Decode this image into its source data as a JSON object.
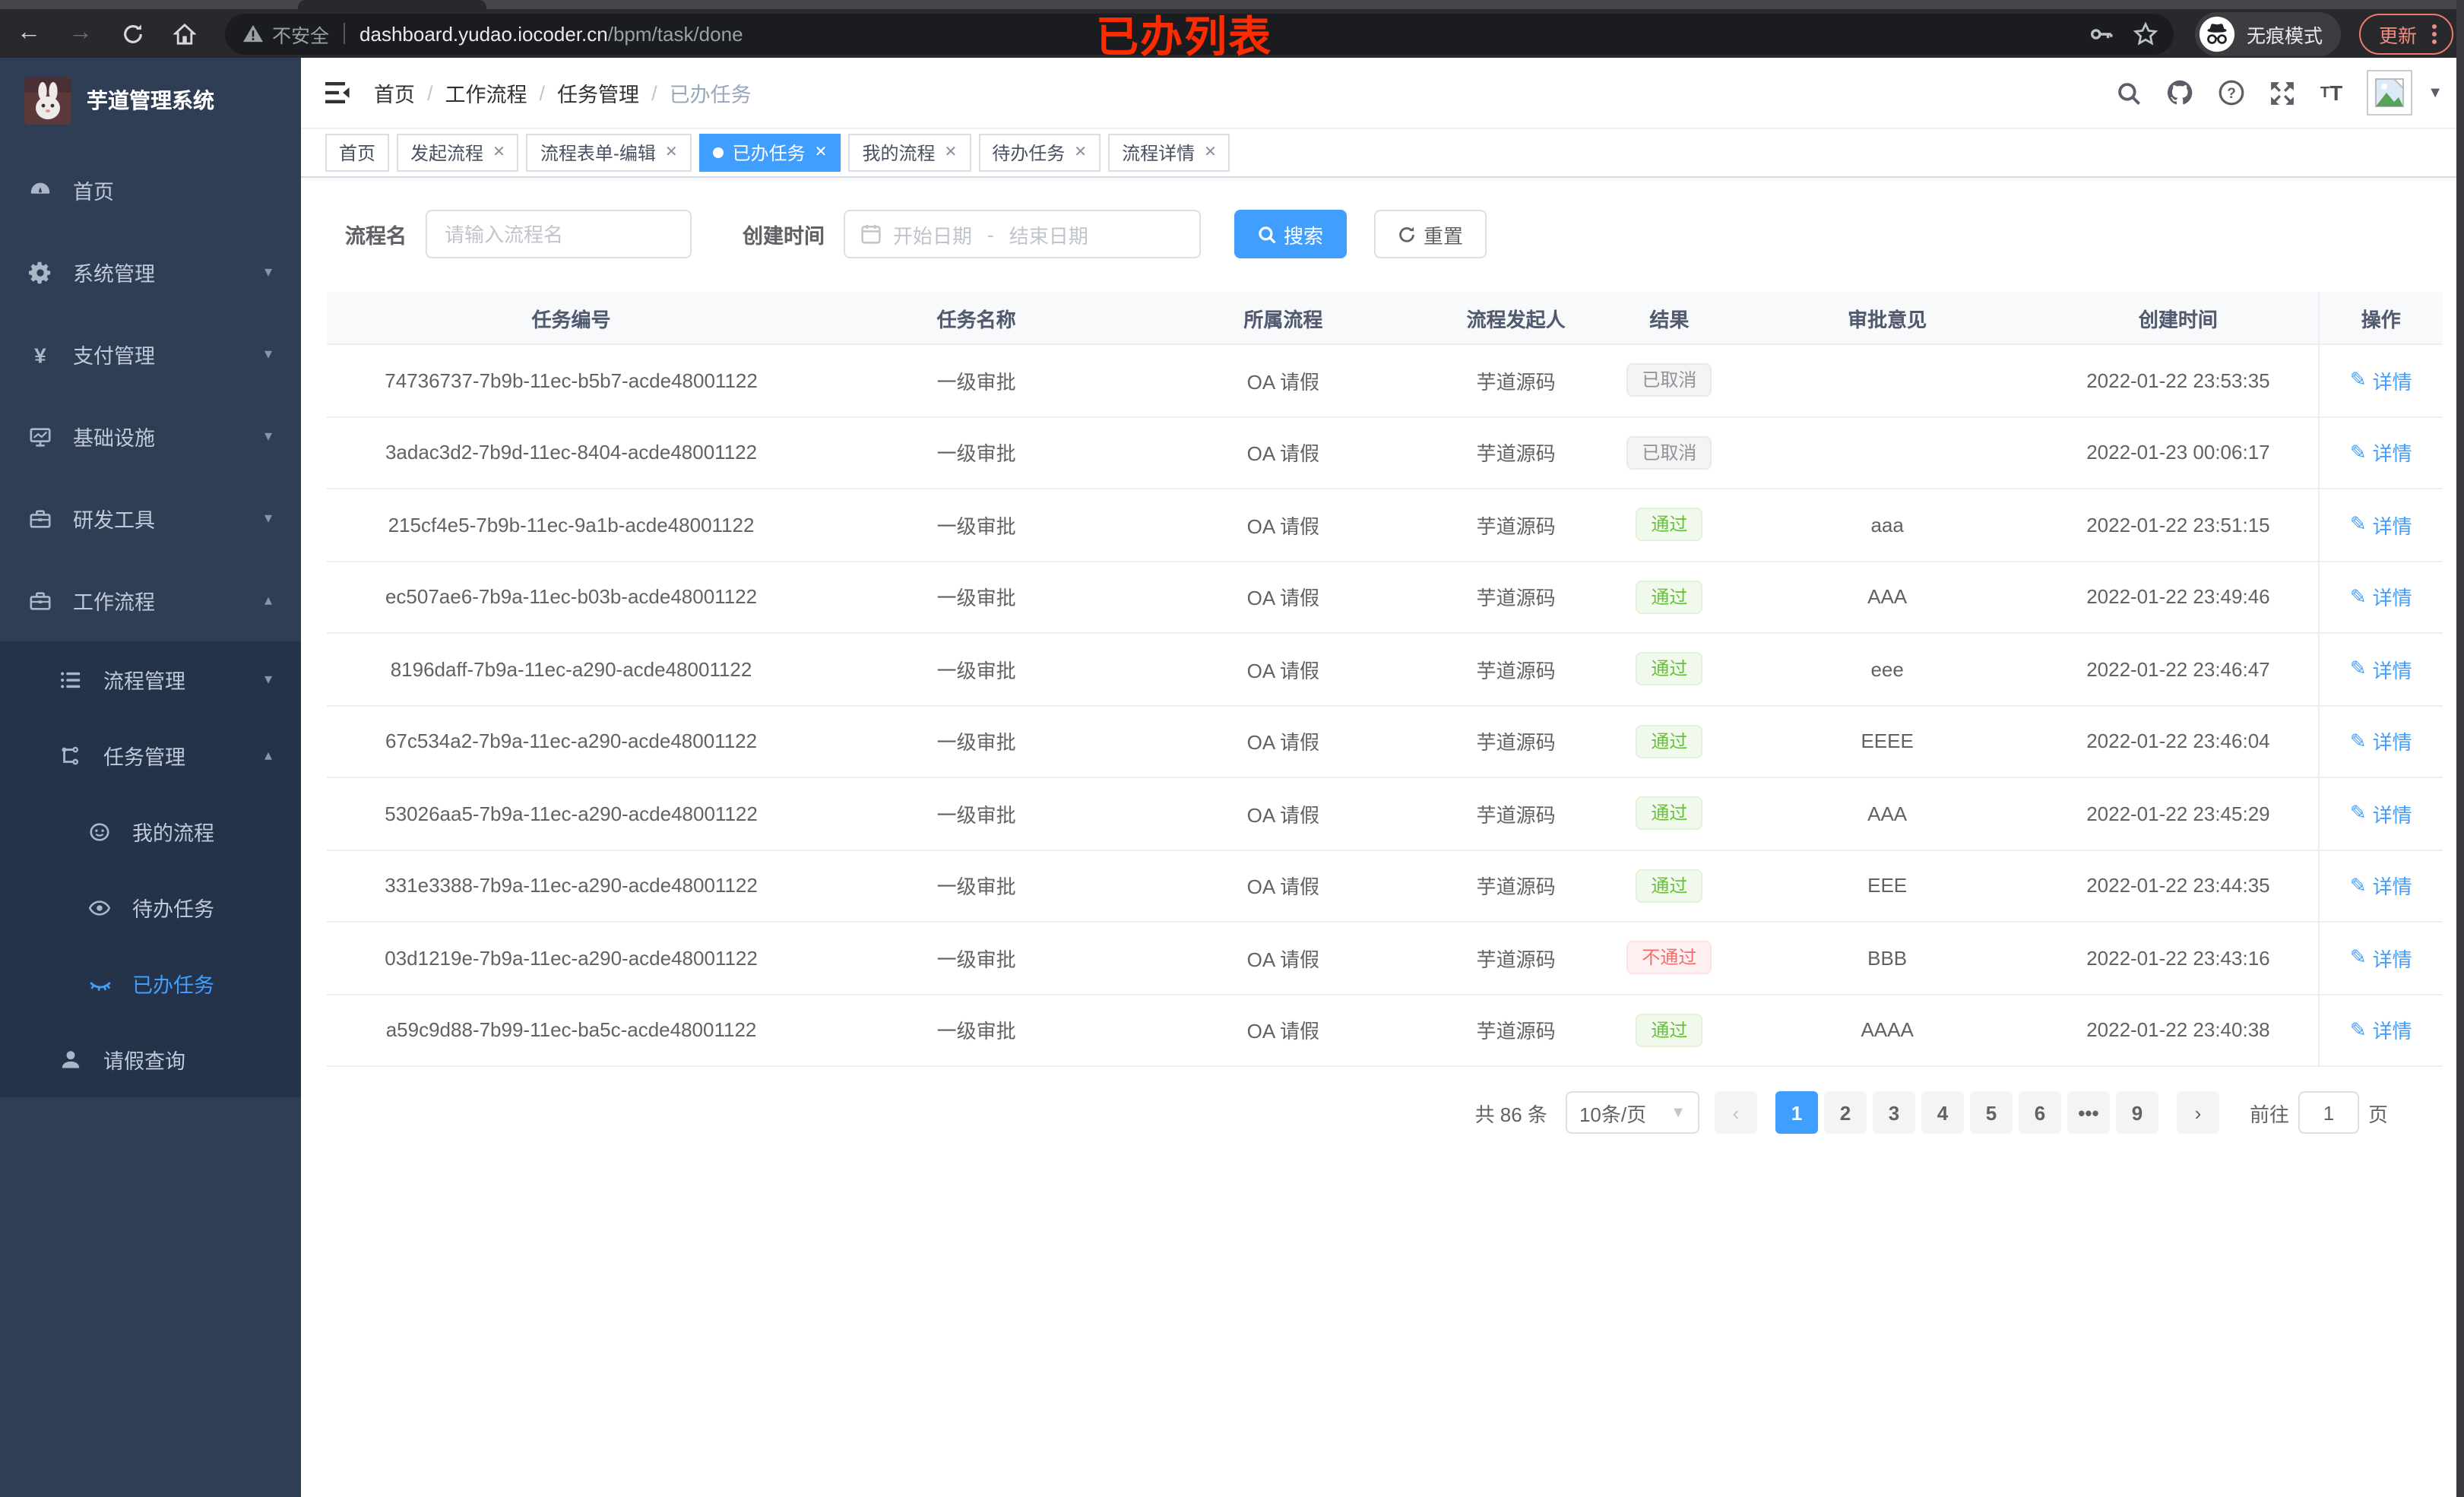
{
  "browser": {
    "security_label": "不安全",
    "url_host": "dashboard.yudao.iocoder.cn",
    "url_path": "/bpm/task/done",
    "incognito_label": "无痕模式",
    "update_label": "更新",
    "annotation": "已办列表"
  },
  "sidebar": {
    "logo_title": "芋道管理系统",
    "items": [
      {
        "label": "首页",
        "icon": "dashboard-icon",
        "level": 1,
        "chevron": "",
        "submenu": false,
        "active": false
      },
      {
        "label": "系统管理",
        "icon": "gear-icon",
        "level": 1,
        "chevron": "down",
        "submenu": false,
        "active": false
      },
      {
        "label": "支付管理",
        "icon": "yen-icon",
        "level": 1,
        "chevron": "down",
        "submenu": false,
        "active": false
      },
      {
        "label": "基础设施",
        "icon": "monitor-icon",
        "level": 1,
        "chevron": "down",
        "submenu": false,
        "active": false
      },
      {
        "label": "研发工具",
        "icon": "toolbox-icon",
        "level": 1,
        "chevron": "down",
        "submenu": false,
        "active": false
      },
      {
        "label": "工作流程",
        "icon": "briefcase-icon",
        "level": 1,
        "chevron": "up",
        "submenu": false,
        "active": false
      },
      {
        "label": "流程管理",
        "icon": "tree-list-icon",
        "level": 2,
        "chevron": "down",
        "submenu": true,
        "active": false
      },
      {
        "label": "任务管理",
        "icon": "flow-icon",
        "level": 2,
        "chevron": "up",
        "submenu": true,
        "active": false
      },
      {
        "label": "我的流程",
        "icon": "face-icon",
        "level": 3,
        "chevron": "",
        "submenu": true,
        "active": false
      },
      {
        "label": "待办任务",
        "icon": "eye-open-icon",
        "level": 3,
        "chevron": "",
        "submenu": true,
        "active": false
      },
      {
        "label": "已办任务",
        "icon": "eye-closed-icon",
        "level": 3,
        "chevron": "",
        "submenu": true,
        "active": true
      },
      {
        "label": "请假查询",
        "icon": "user-icon",
        "level": 2,
        "chevron": "",
        "submenu": true,
        "active": false
      }
    ]
  },
  "breadcrumb": [
    "首页",
    "工作流程",
    "任务管理",
    "已办任务"
  ],
  "tabs": [
    {
      "label": "首页",
      "closable": false,
      "active": false
    },
    {
      "label": "发起流程",
      "closable": true,
      "active": false
    },
    {
      "label": "流程表单-编辑",
      "closable": true,
      "active": false
    },
    {
      "label": "已办任务",
      "closable": true,
      "active": true
    },
    {
      "label": "我的流程",
      "closable": true,
      "active": false
    },
    {
      "label": "待办任务",
      "closable": true,
      "active": false
    },
    {
      "label": "流程详情",
      "closable": true,
      "active": false
    }
  ],
  "filters": {
    "name_label": "流程名",
    "name_placeholder": "请输入流程名",
    "time_label": "创建时间",
    "date_start_placeholder": "开始日期",
    "date_separator": "-",
    "date_end_placeholder": "结束日期",
    "search_label": "搜索",
    "reset_label": "重置"
  },
  "table": {
    "columns": [
      "任务编号",
      "任务名称",
      "所属流程",
      "流程发起人",
      "结果",
      "审批意见",
      "创建时间",
      "操作"
    ],
    "detail_label": "详情",
    "rows": [
      {
        "id": "74736737-7b9b-11ec-b5b7-acde48001122",
        "name": "一级审批",
        "process": "OA 请假",
        "starter": "芋道源码",
        "result": "已取消",
        "result_type": "info",
        "comment": "",
        "created": "2022-01-22 23:53:35"
      },
      {
        "id": "3adac3d2-7b9d-11ec-8404-acde48001122",
        "name": "一级审批",
        "process": "OA 请假",
        "starter": "芋道源码",
        "result": "已取消",
        "result_type": "info",
        "comment": "",
        "created": "2022-01-23 00:06:17"
      },
      {
        "id": "215cf4e5-7b9b-11ec-9a1b-acde48001122",
        "name": "一级审批",
        "process": "OA 请假",
        "starter": "芋道源码",
        "result": "通过",
        "result_type": "success",
        "comment": "aaa",
        "created": "2022-01-22 23:51:15"
      },
      {
        "id": "ec507ae6-7b9a-11ec-b03b-acde48001122",
        "name": "一级审批",
        "process": "OA 请假",
        "starter": "芋道源码",
        "result": "通过",
        "result_type": "success",
        "comment": "AAA",
        "created": "2022-01-22 23:49:46"
      },
      {
        "id": "8196daff-7b9a-11ec-a290-acde48001122",
        "name": "一级审批",
        "process": "OA 请假",
        "starter": "芋道源码",
        "result": "通过",
        "result_type": "success",
        "comment": "eee",
        "created": "2022-01-22 23:46:47"
      },
      {
        "id": "67c534a2-7b9a-11ec-a290-acde48001122",
        "name": "一级审批",
        "process": "OA 请假",
        "starter": "芋道源码",
        "result": "通过",
        "result_type": "success",
        "comment": "EEEE",
        "created": "2022-01-22 23:46:04"
      },
      {
        "id": "53026aa5-7b9a-11ec-a290-acde48001122",
        "name": "一级审批",
        "process": "OA 请假",
        "starter": "芋道源码",
        "result": "通过",
        "result_type": "success",
        "comment": "AAA",
        "created": "2022-01-22 23:45:29"
      },
      {
        "id": "331e3388-7b9a-11ec-a290-acde48001122",
        "name": "一级审批",
        "process": "OA 请假",
        "starter": "芋道源码",
        "result": "通过",
        "result_type": "success",
        "comment": "EEE",
        "created": "2022-01-22 23:44:35"
      },
      {
        "id": "03d1219e-7b9a-11ec-a290-acde48001122",
        "name": "一级审批",
        "process": "OA 请假",
        "starter": "芋道源码",
        "result": "不通过",
        "result_type": "danger",
        "comment": "BBB",
        "created": "2022-01-22 23:43:16"
      },
      {
        "id": "a59c9d88-7b99-11ec-ba5c-acde48001122",
        "name": "一级审批",
        "process": "OA 请假",
        "starter": "芋道源码",
        "result": "通过",
        "result_type": "success",
        "comment": "AAAA",
        "created": "2022-01-22 23:40:38"
      }
    ]
  },
  "pagination": {
    "total_label": "共 86 条",
    "page_size_label": "10条/页",
    "pages": [
      "1",
      "2",
      "3",
      "4",
      "5",
      "6",
      "•••",
      "9"
    ],
    "active_page": "1",
    "goto_label": "前往",
    "goto_value": "1",
    "goto_suffix_label": "页"
  },
  "colors": {
    "accent": "#409eff",
    "success": "#67c23a",
    "danger": "#f56c6c",
    "info": "#909399",
    "sidebar_bg": "#2f3e55",
    "annotation_red": "#ff2b00"
  }
}
